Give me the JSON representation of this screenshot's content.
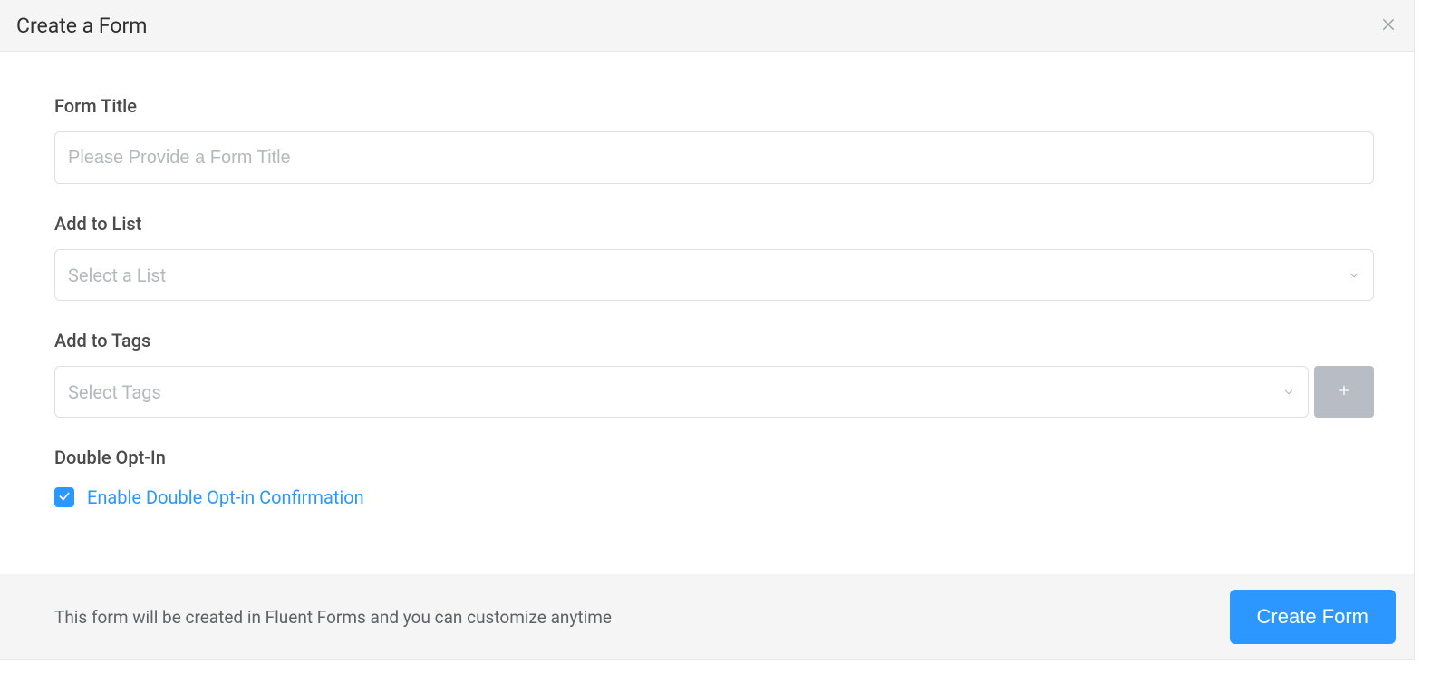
{
  "header": {
    "title": "Create a Form"
  },
  "form": {
    "title_label": "Form Title",
    "title_placeholder": "Please Provide a Form Title",
    "title_value": "",
    "list_label": "Add to List",
    "list_placeholder": "Select a List",
    "tags_label": "Add to Tags",
    "tags_placeholder": "Select Tags",
    "optin_label": "Double Opt-In",
    "optin_checkbox_label": "Enable Double Opt-in Confirmation",
    "optin_checked": true
  },
  "footer": {
    "note": "This form will be created in Fluent Forms and you can customize anytime",
    "create_button": "Create Form"
  }
}
